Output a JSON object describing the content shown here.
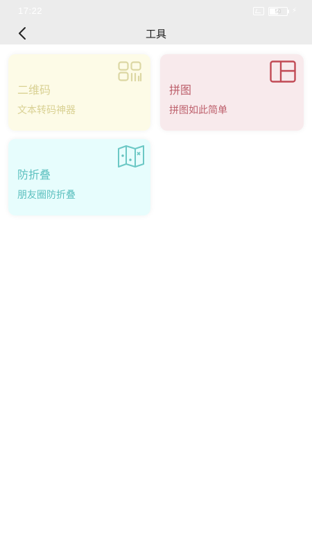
{
  "status_bar": {
    "time": "17:22",
    "battery_level": "50",
    "battery_fraction": 0.5
  },
  "header": {
    "title": "工具",
    "back_icon": "chevron-left-icon"
  },
  "tools": [
    {
      "title": "二维码",
      "subtitle": "文本转码神器",
      "icon": "qr-code-icon",
      "bg_color": "#fdfbe7",
      "text_color": "#d9d193",
      "icon_color": "#dcd7a3"
    },
    {
      "title": "拼图",
      "subtitle": "拼图如此简单",
      "icon": "layout-grid-icon",
      "bg_color": "#f8eaec",
      "text_color": "#bd5f6b",
      "icon_color": "#c14a55"
    },
    {
      "title": "防折叠",
      "subtitle": "朋友圈防折叠",
      "icon": "map-icon",
      "bg_color": "#e7fdfd",
      "text_color": "#5cc0bf",
      "icon_color": "#6cc8c5"
    }
  ]
}
